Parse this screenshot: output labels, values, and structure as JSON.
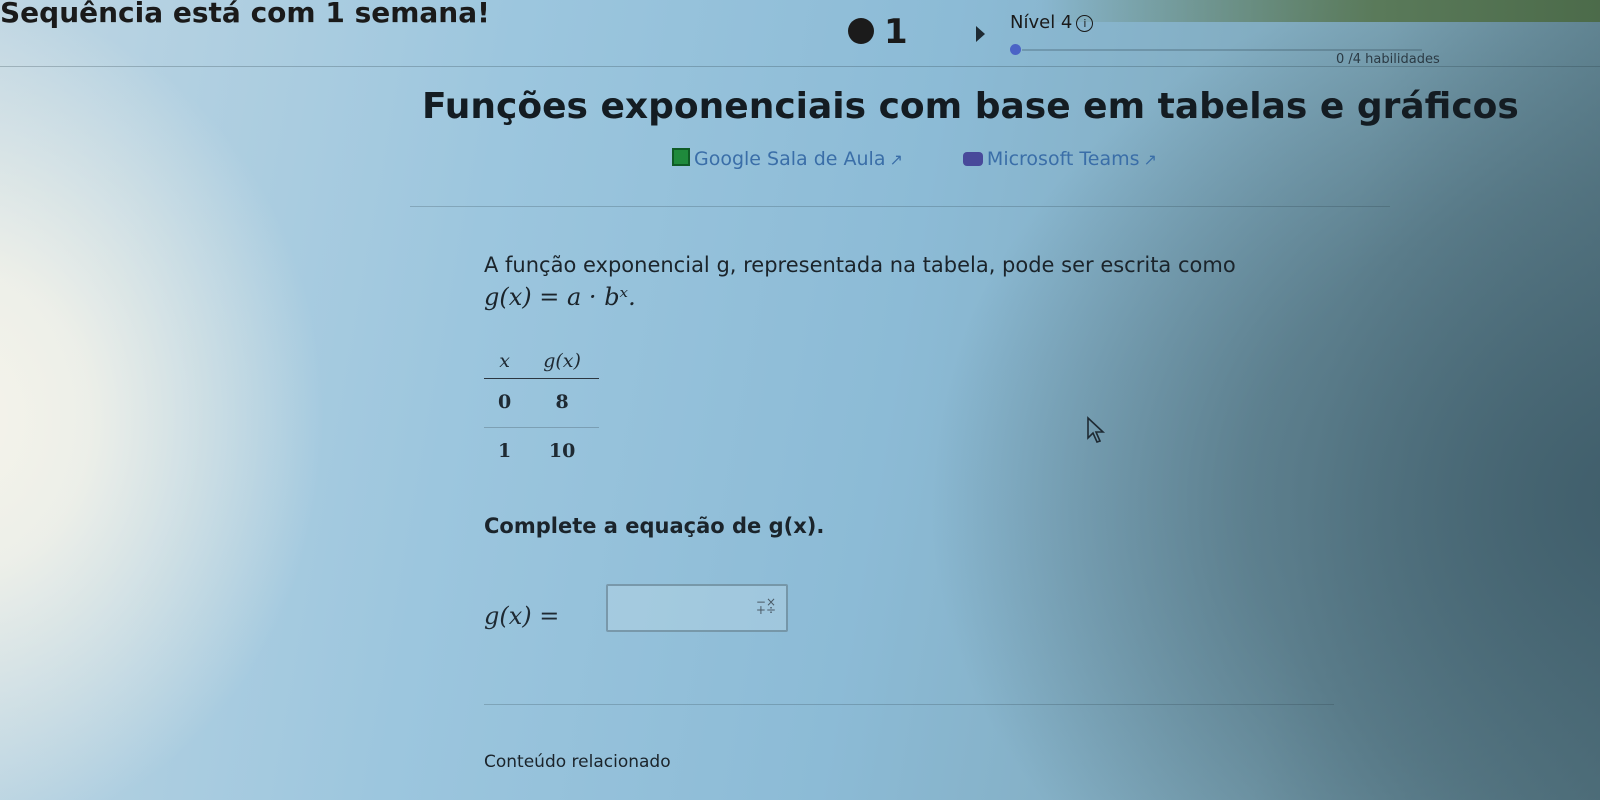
{
  "header": {
    "sequence_text": "Sequência está com 1 semana!",
    "streak_count": "1",
    "level_label": "Nível 4",
    "info_glyph": "i",
    "skills_progress": "0 /4 habilidades"
  },
  "page": {
    "title": "Funções exponenciais com base em tabelas e gráficos",
    "links": [
      {
        "label": "Google Sala de Aula",
        "icon": "google-classroom-icon"
      },
      {
        "label": "Microsoft Teams",
        "icon": "microsoft-teams-icon"
      }
    ],
    "external_glyph": "↗"
  },
  "problem": {
    "prompt": "A função exponencial g, representada na tabela, pode ser escrita como",
    "formula": "g(x) = a · bˣ.",
    "table": {
      "headers": [
        "x",
        "g(x)"
      ],
      "rows": [
        [
          "0",
          "8"
        ],
        [
          "1",
          "10"
        ]
      ]
    },
    "question": "Complete a equação de g(x).",
    "answer_label": "g(x) =",
    "answer_value": ""
  },
  "footer": {
    "related": "Conteúdo relacionado"
  },
  "colors": {
    "link": "#3a6ea8",
    "level_dot": "#4b63c6",
    "google_classroom": "#1f8a3c",
    "teams": "#48499a"
  }
}
